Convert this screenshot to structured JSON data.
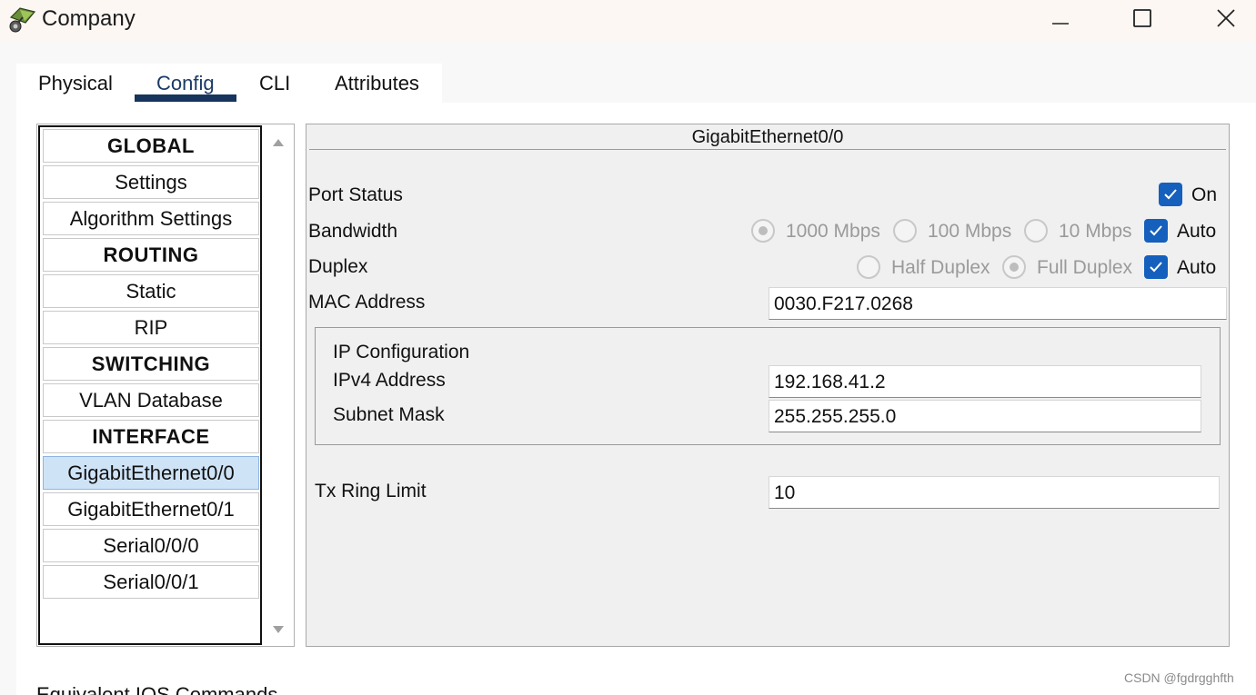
{
  "window": {
    "title": "Company",
    "icon": "router-icon"
  },
  "tabs": [
    {
      "label": "Physical"
    },
    {
      "label": "Config"
    },
    {
      "label": "CLI"
    },
    {
      "label": "Attributes"
    }
  ],
  "active_tab": "Config",
  "nav": {
    "items": [
      {
        "label": "GLOBAL",
        "header": true
      },
      {
        "label": "Settings"
      },
      {
        "label": "Algorithm Settings"
      },
      {
        "label": "ROUTING",
        "header": true
      },
      {
        "label": "Static"
      },
      {
        "label": "RIP"
      },
      {
        "label": "SWITCHING",
        "header": true
      },
      {
        "label": "VLAN Database"
      },
      {
        "label": "INTERFACE",
        "header": true
      },
      {
        "label": "GigabitEthernet0/0",
        "selected": true
      },
      {
        "label": "GigabitEthernet0/1"
      },
      {
        "label": "Serial0/0/0"
      },
      {
        "label": "Serial0/0/1"
      }
    ]
  },
  "config": {
    "header": "GigabitEthernet0/0",
    "port_status": {
      "label": "Port Status",
      "on_label": "On",
      "checked": true
    },
    "bandwidth": {
      "label": "Bandwidth",
      "options": [
        "1000 Mbps",
        "100 Mbps",
        "10 Mbps"
      ],
      "selected": "1000 Mbps",
      "auto_label": "Auto",
      "auto_checked": true
    },
    "duplex": {
      "label": "Duplex",
      "options": [
        "Half Duplex",
        "Full Duplex"
      ],
      "selected": "Full Duplex",
      "auto_label": "Auto",
      "auto_checked": true
    },
    "mac": {
      "label": "MAC Address",
      "value": "0030.F217.0268"
    },
    "ip_group": {
      "title": "IP Configuration",
      "ipv4_label": "IPv4 Address",
      "ipv4_value": "192.168.41.2",
      "mask_label": "Subnet Mask",
      "mask_value": "255.255.255.0"
    },
    "tx_ring": {
      "label": "Tx Ring Limit",
      "value": "10"
    }
  },
  "footer": {
    "label": "Equivalent IOS Commands"
  },
  "watermark": "CSDN @fgdrgghfth",
  "colors": {
    "accent": "#1560bd",
    "tab_underline": "#16345c",
    "selected_item": "#cfe3f7"
  }
}
